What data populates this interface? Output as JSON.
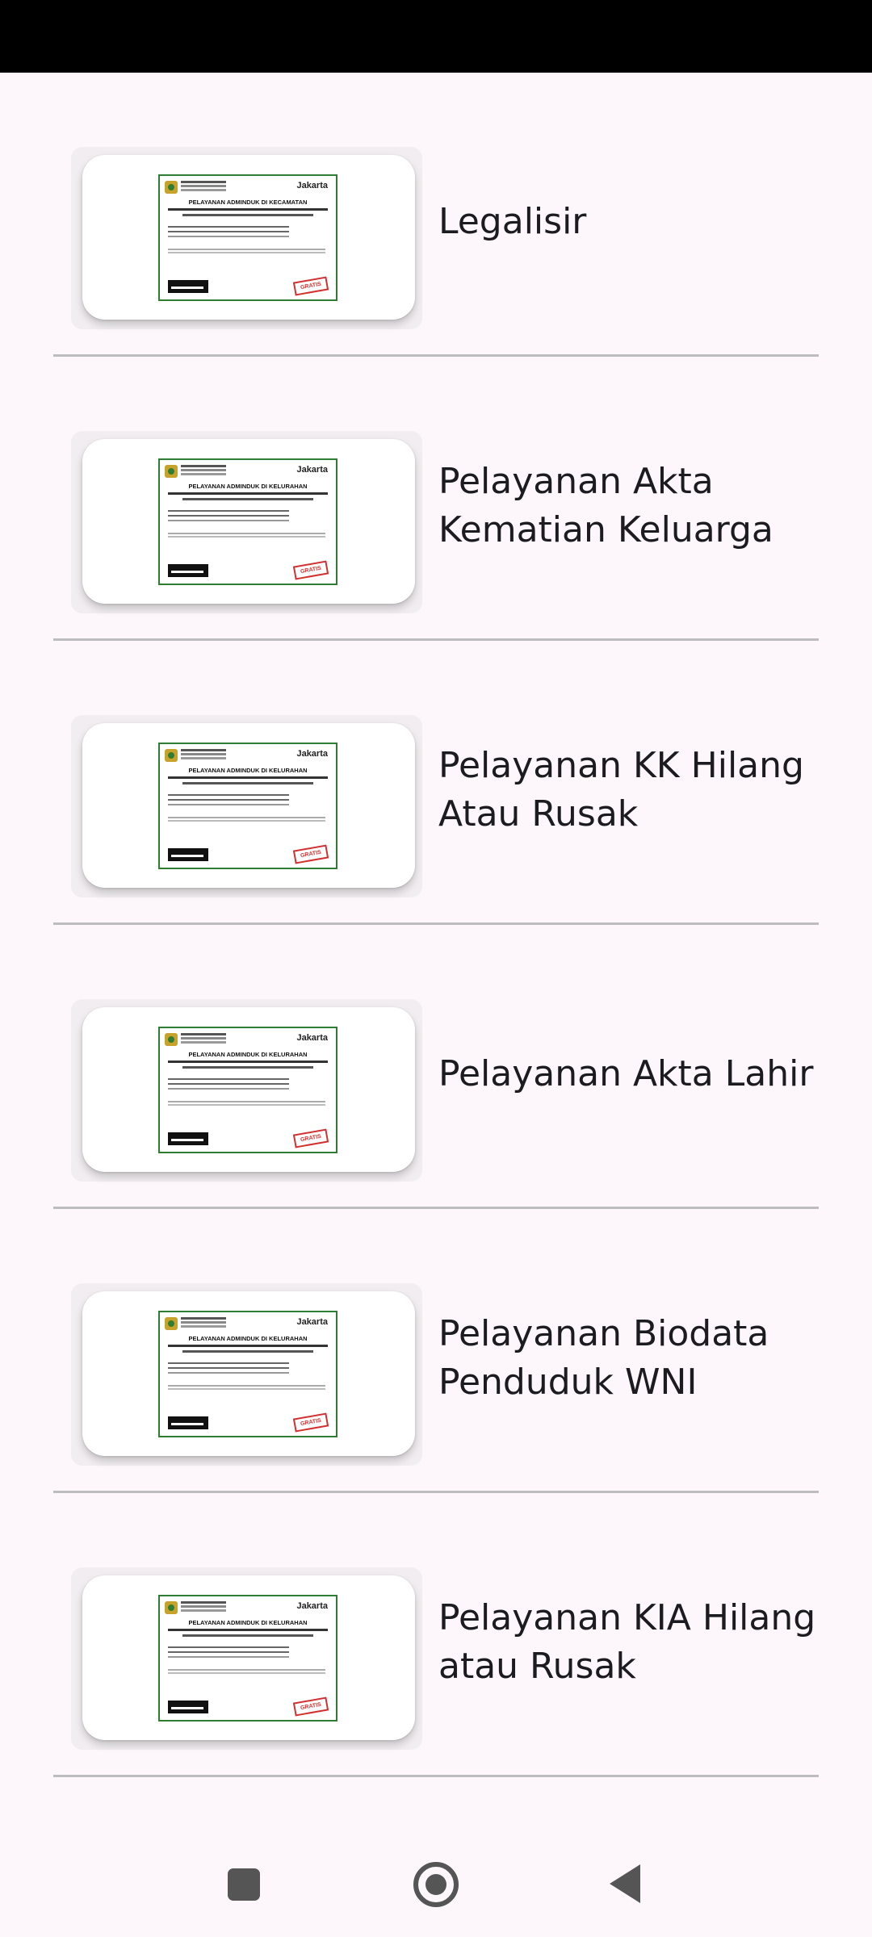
{
  "services": [
    {
      "label": "Legalisir",
      "poster": {
        "title": "PELAYANAN ADMINDUK DI KECAMATAN",
        "brand": "Jakarta",
        "stamp": "GRATIS"
      }
    },
    {
      "label": "Pelayanan Akta Kematian Keluarga",
      "poster": {
        "title": "PELAYANAN ADMINDUK DI KELURAHAN",
        "brand": "Jakarta",
        "stamp": "GRATIS"
      }
    },
    {
      "label": "Pelayanan KK Hilang Atau Rusak",
      "poster": {
        "title": "PELAYANAN ADMINDUK DI KELURAHAN",
        "brand": "Jakarta",
        "stamp": "GRATIS"
      }
    },
    {
      "label": "Pelayanan Akta Lahir",
      "poster": {
        "title": "PELAYANAN ADMINDUK DI KELURAHAN",
        "brand": "Jakarta",
        "stamp": "GRATIS"
      }
    },
    {
      "label": "Pelayanan Biodata Penduduk WNI",
      "poster": {
        "title": "PELAYANAN ADMINDUK DI KELURAHAN",
        "brand": "Jakarta",
        "stamp": "GRATIS"
      }
    },
    {
      "label": "Pelayanan KIA Hilang atau Rusak",
      "poster": {
        "title": "PELAYANAN ADMINDUK DI KELURAHAN",
        "brand": "Jakarta",
        "stamp": "GRATIS"
      }
    }
  ],
  "colors": {
    "background": "#fdf7fb",
    "divider": "#bdbdbd",
    "poster_border": "#2e7d32",
    "stamp": "#d32f2f"
  },
  "nav": {
    "recents_icon": "square-icon",
    "home_icon": "circle-home-icon",
    "back_icon": "triangle-back-icon"
  }
}
